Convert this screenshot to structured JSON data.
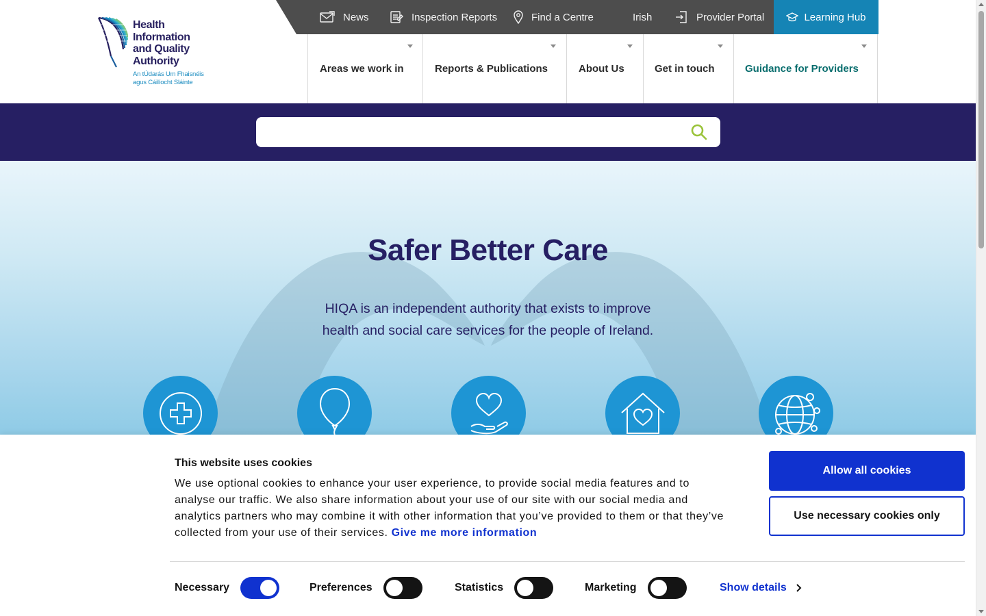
{
  "logo": {
    "name_lines": [
      "Health",
      "Information",
      "and Quality",
      "Authority"
    ],
    "irish_lines": [
      "An tÚdarás Um Fhaisnéis",
      "agus Cáilíocht Sláinte"
    ]
  },
  "topbar": {
    "items": [
      {
        "label": "News",
        "icon": "envelope-icon"
      },
      {
        "label": "Inspection Reports",
        "icon": "report-icon"
      },
      {
        "label": "Find a Centre",
        "icon": "location-pin-icon"
      },
      {
        "label": "Irish",
        "icon": ""
      },
      {
        "label": "Provider Portal",
        "icon": "login-icon"
      }
    ],
    "learning_hub": {
      "label": "Learning Hub",
      "icon": "graduation-cap-icon"
    }
  },
  "mainnav": {
    "items": [
      {
        "label": "Areas we work in"
      },
      {
        "label": "Reports & Publications"
      },
      {
        "label": "About Us"
      },
      {
        "label": "Get in touch"
      },
      {
        "label": "Guidance for Providers"
      }
    ]
  },
  "search": {
    "placeholder": "",
    "value": ""
  },
  "hero": {
    "title": "Safer Better Care",
    "subtitle": "HIQA is an independent authority that exists to improve health and social care services for the people of Ireland.",
    "icons": [
      "medical-cross-icon",
      "balloon-icon",
      "heart-in-hand-icon",
      "house-heart-icon",
      "globe-network-icon"
    ]
  },
  "cookie": {
    "title": "This website uses cookies",
    "text": "We use optional cookies to enhance your user experience, to provide social media features and to analyse our traffic. We also share information about your use of our site with our social media and analytics partners who may combine it with other information that you’ve provided to them or that they’ve collected from your use of their services.",
    "more_link": "Give me more information",
    "allow_all": "Allow all cookies",
    "necessary_only": "Use necessary cookies only",
    "toggles": [
      {
        "label": "Necessary",
        "on": true
      },
      {
        "label": "Preferences",
        "on": false
      },
      {
        "label": "Statistics",
        "on": false
      },
      {
        "label": "Marketing",
        "on": false
      }
    ],
    "show_details": "Show details"
  },
  "colors": {
    "navy": "#261f63",
    "topbar": "#4d4d4d",
    "learning_hub": "#1584b5",
    "accent_teal": "#0a6e6e",
    "cookie_blue": "#1032cf",
    "circle_blue": "#1e95d4",
    "search_icon": "#9ac33a"
  }
}
